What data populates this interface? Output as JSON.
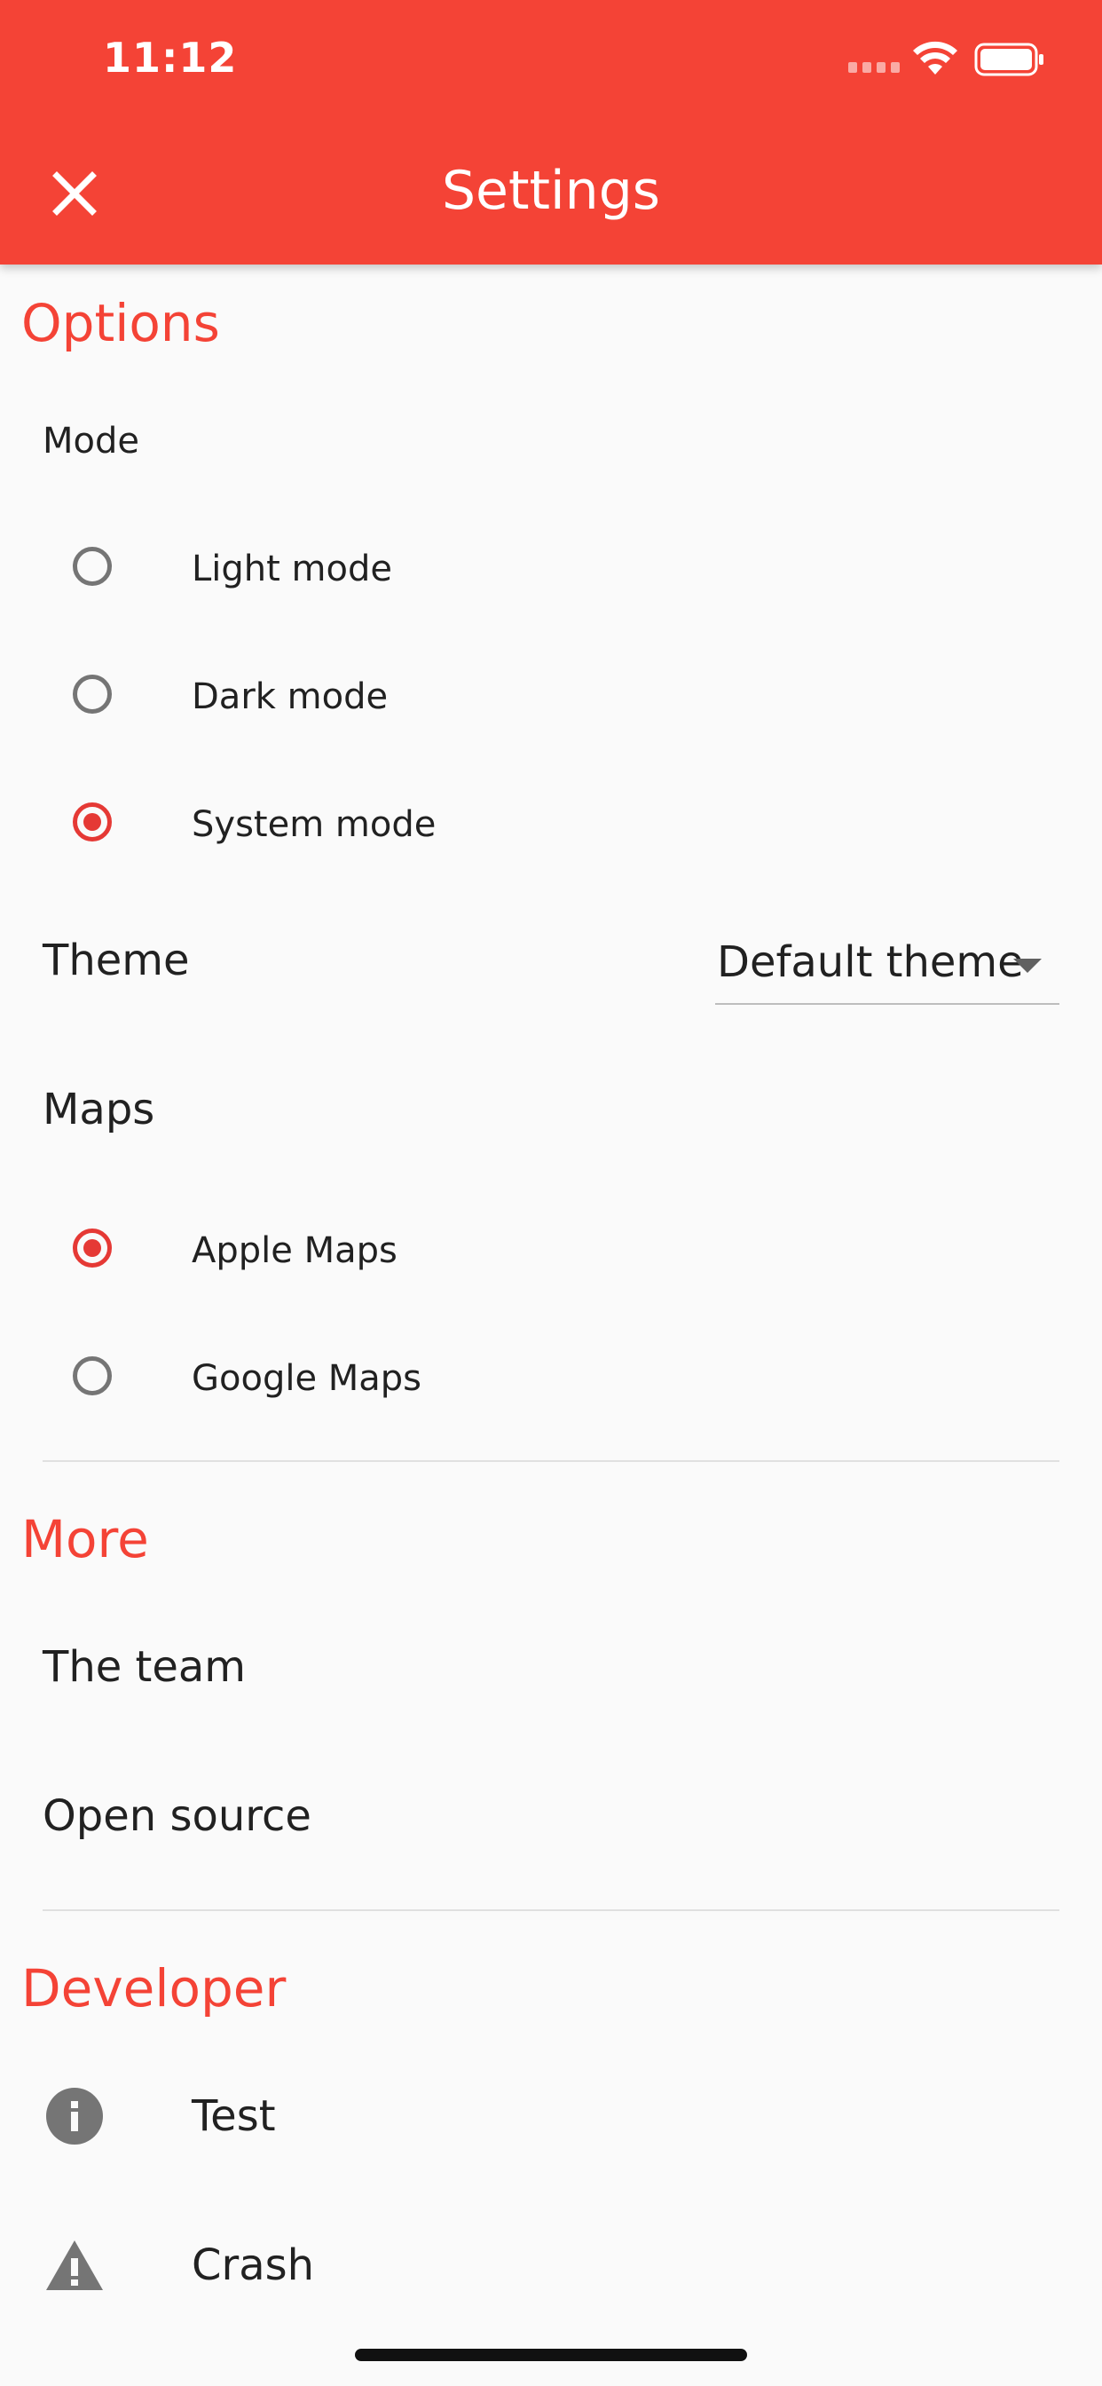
{
  "status_bar": {
    "time": "11:12"
  },
  "app_bar": {
    "title": "Settings",
    "close_icon": "close-icon"
  },
  "options": {
    "header": "Options",
    "mode_label": "Mode",
    "mode_options": [
      {
        "label": "Light mode",
        "selected": false
      },
      {
        "label": "Dark mode",
        "selected": false
      },
      {
        "label": "System mode",
        "selected": true
      }
    ],
    "theme_label": "Theme",
    "theme_value": "Default theme",
    "maps_label": "Maps",
    "maps_options": [
      {
        "label": "Apple Maps",
        "selected": true
      },
      {
        "label": "Google Maps",
        "selected": false
      }
    ]
  },
  "more": {
    "header": "More",
    "items": [
      "The team",
      "Open source"
    ]
  },
  "developer": {
    "header": "Developer",
    "items": [
      {
        "label": "Test",
        "icon": "info-icon"
      },
      {
        "label": "Crash",
        "icon": "warning-icon"
      }
    ]
  },
  "colors": {
    "accent": "#f44336",
    "radio_selected": "#e53935"
  }
}
